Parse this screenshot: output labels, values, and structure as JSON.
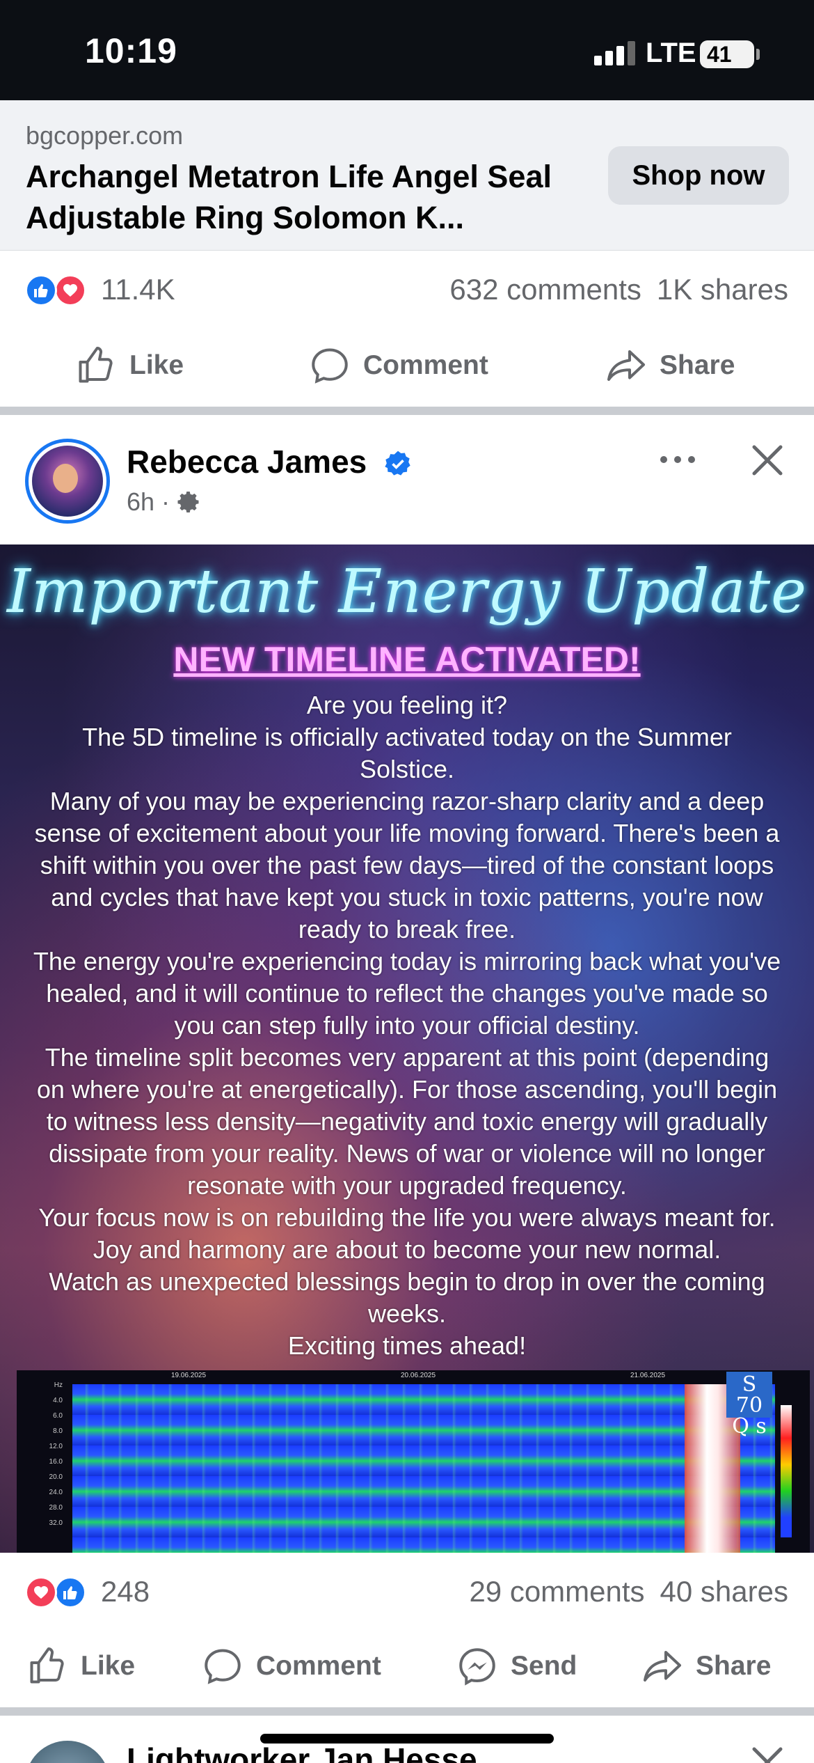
{
  "status_bar": {
    "time": "10:19",
    "network": "LTE",
    "battery": "41"
  },
  "ad": {
    "domain": "bgcopper.com",
    "title": "Archangel Metatron Life Angel Seal Adjustable Ring Solomon K...",
    "cta": "Shop now"
  },
  "ad_stats": {
    "reactions": "11.4K",
    "comments": "632 comments",
    "shares": "1K shares"
  },
  "ad_actions": {
    "like": "Like",
    "comment": "Comment",
    "share": "Share"
  },
  "post": {
    "author": "Rebecca James",
    "time": "6h ·",
    "image": {
      "headline": "Important Energy Update",
      "subhead": "NEW TIMELINE ACTIVATED!",
      "lines": [
        "Are you feeling it?",
        "The 5D timeline is officially activated today on the Summer",
        "Solstice.",
        "Many of you may be experiencing razor-sharp clarity and a deep",
        "sense of excitement about your life moving forward. There's been a",
        "shift within you over the past few days—tired of the constant loops",
        "and cycles that have kept you stuck in toxic patterns, you're now",
        "ready to break free.",
        "The energy you're experiencing today is mirroring back what you've",
        "healed, and it will continue to reflect the changes you've made so",
        "you can step fully into your official destiny.",
        "The timeline split becomes very apparent at this point (depending",
        "on where you're at energetically). For those ascending, you'll begin",
        "to witness less density—negativity and toxic energy will gradually",
        "dissipate from your reality. News of war or violence will no longer",
        "resonate with your upgraded frequency.",
        "Your focus now is on rebuilding the life you were always meant for.",
        "Joy and harmony are about to become your new normal.",
        "Watch as unexpected blessings begin to drop in over the coming",
        "weeks.",
        "Exciting times ahead!"
      ],
      "spectrogram": {
        "dates": [
          "19.06.2025",
          "20.06.2025",
          "21.06.2025"
        ],
        "y_ticks": [
          "Hz",
          "4.0",
          "6.0",
          "8.0",
          "12.0",
          "16.0",
          "20.0",
          "24.0",
          "28.0",
          "32.0"
        ],
        "logo_text": "S 70 Q s"
      }
    }
  },
  "post_stats": {
    "reactions": "248",
    "comments": "29 comments",
    "shares": "40 shares"
  },
  "post_actions": {
    "like": "Like",
    "comment": "Comment",
    "send": "Send",
    "share": "Share"
  },
  "next_post": {
    "author": "Lightworker Jan Hesse"
  },
  "colors": {
    "facebook_blue": "#1877f2",
    "love_red": "#f33e58",
    "secondary_text": "#65676b",
    "headline_glow": "#5ee7ff",
    "subhead_pink": "#ffb3ff"
  }
}
